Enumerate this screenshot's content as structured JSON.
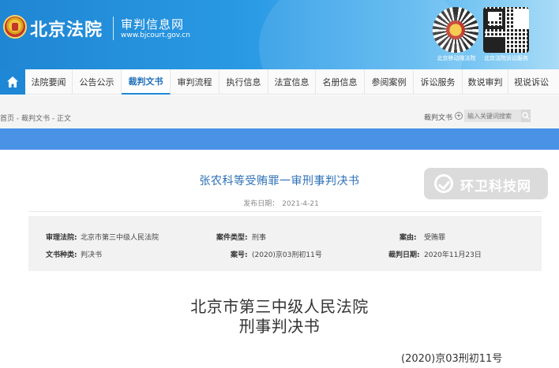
{
  "header": {
    "court_name": "北京法院",
    "site_title": "审判信息网",
    "site_url": "www.bjcourt.gov.cn",
    "qr_codes": [
      {
        "caption": "北京移动微法院",
        "icon": "emblem-qr-icon"
      },
      {
        "caption": "北京法院诉讼服务",
        "icon": "qr-code-icon"
      }
    ]
  },
  "nav": {
    "home_icon": "home-icon",
    "items": [
      {
        "label": "法院要闻",
        "active": false
      },
      {
        "label": "公告公示",
        "active": false
      },
      {
        "label": "裁判文书",
        "active": true
      },
      {
        "label": "审判流程",
        "active": false
      },
      {
        "label": "执行信息",
        "active": false
      },
      {
        "label": "法宣信息",
        "active": false
      },
      {
        "label": "名册信息",
        "active": false
      },
      {
        "label": "参阅案例",
        "active": false
      },
      {
        "label": "诉讼服务",
        "active": false
      },
      {
        "label": "数说审判",
        "active": false
      },
      {
        "label": "视说诉讼",
        "active": false
      }
    ]
  },
  "breadcrumb": "首页 - 裁判文书 - 正文",
  "search": {
    "label": "裁判文书",
    "plus": "+",
    "placeholder": "输入关键词搜索"
  },
  "watermark": {
    "text": "环卫科技网"
  },
  "document": {
    "title": "张农科等受贿罪一审刑事判决书",
    "publish_label": "发布日期：",
    "publish_date": "2021-4-21",
    "info": {
      "court_label": "审理法院:",
      "court_value": "北京市第三中级人民法院",
      "case_type_label": "案件类型:",
      "case_type_value": "刑事",
      "cause_label": "案由:",
      "cause_value": "受贿罪",
      "doc_type_label": "文书种类:",
      "doc_type_value": "判决书",
      "case_no_label": "案号:",
      "case_no_value": "(2020)京03刑初11号",
      "judge_date_label": "裁判日期:",
      "judge_date_value": "2020年11月23日"
    },
    "body_court": "北京市第三中级人民法院",
    "body_doc_type": "刑事判决书",
    "body_case_no": "(2020)京03刑初11号"
  },
  "colors": {
    "header_blue": "#1f86d3",
    "nav_active": "#1e87d6",
    "title_blue": "#2a6fb5",
    "bar_blue": "#4a92e6"
  }
}
